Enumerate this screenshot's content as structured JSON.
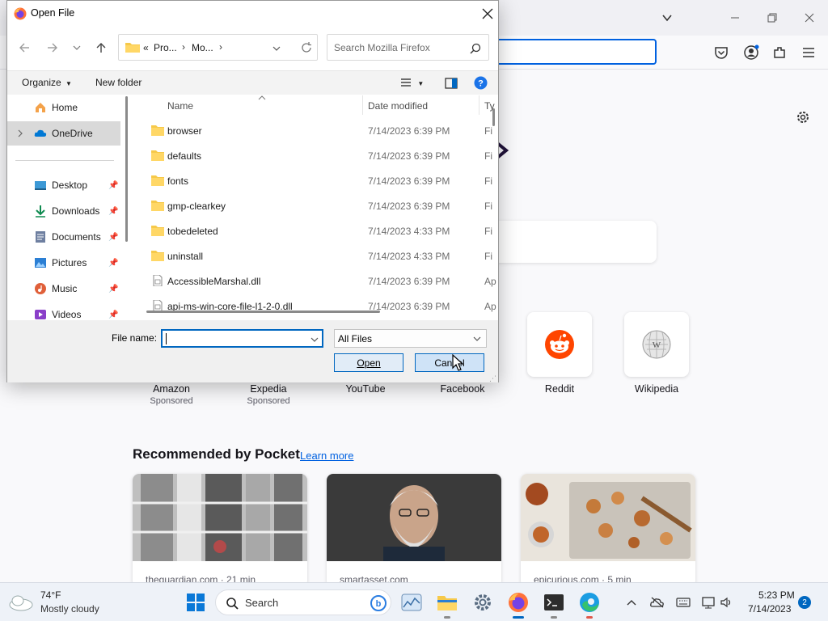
{
  "firefox": {
    "new_tab": {
      "top_sites": [
        {
          "label": "Amazon",
          "sublabel": "Sponsored"
        },
        {
          "label": "Expedia",
          "sublabel": "Sponsored"
        },
        {
          "label": "YouTube",
          "sublabel": ""
        },
        {
          "label": "Facebook",
          "sublabel": ""
        },
        {
          "label": "Reddit",
          "sublabel": ""
        },
        {
          "label": "Wikipedia",
          "sublabel": ""
        }
      ],
      "pocket": {
        "heading": "Recommended by Pocket",
        "learn_more": "Learn more",
        "cards": [
          {
            "source": "theguardian.com · 21 min"
          },
          {
            "source": "smartasset.com"
          },
          {
            "source": "epicurious.com · 5 min"
          }
        ]
      }
    }
  },
  "dialog": {
    "title": "Open File",
    "breadcrumb": {
      "prefix": "«",
      "items": [
        "Pro...",
        "Mo..."
      ]
    },
    "search_placeholder": "Search Mozilla Firefox",
    "commands": {
      "organize": "Organize",
      "new_folder": "New folder"
    },
    "nav": {
      "home": "Home",
      "onedrive": "OneDrive",
      "quick_access": [
        {
          "label": "Desktop",
          "icon": "desktop-icon"
        },
        {
          "label": "Downloads",
          "icon": "download-icon"
        },
        {
          "label": "Documents",
          "icon": "document-icon"
        },
        {
          "label": "Pictures",
          "icon": "pictures-icon"
        },
        {
          "label": "Music",
          "icon": "music-icon"
        },
        {
          "label": "Videos",
          "icon": "video-icon"
        }
      ]
    },
    "columns": {
      "name": "Name",
      "date": "Date modified",
      "type": "Ty"
    },
    "files": [
      {
        "name": "browser",
        "date": "7/14/2023 6:39 PM",
        "type": "Fi",
        "kind": "folder"
      },
      {
        "name": "defaults",
        "date": "7/14/2023 6:39 PM",
        "type": "Fi",
        "kind": "folder"
      },
      {
        "name": "fonts",
        "date": "7/14/2023 6:39 PM",
        "type": "Fi",
        "kind": "folder"
      },
      {
        "name": "gmp-clearkey",
        "date": "7/14/2023 6:39 PM",
        "type": "Fi",
        "kind": "folder"
      },
      {
        "name": "tobedeleted",
        "date": "7/14/2023 4:33 PM",
        "type": "Fi",
        "kind": "folder"
      },
      {
        "name": "uninstall",
        "date": "7/14/2023 4:33 PM",
        "type": "Fi",
        "kind": "folder"
      },
      {
        "name": "AccessibleMarshal.dll",
        "date": "7/14/2023 6:39 PM",
        "type": "Ap",
        "kind": "file"
      },
      {
        "name": "api-ms-win-core-file-l1-2-0.dll",
        "date": "7/14/2023 6:39 PM",
        "type": "Ap",
        "kind": "file"
      }
    ],
    "file_name_label": "File name:",
    "file_name_value": "",
    "filter": "All Files",
    "open_button": "Open",
    "cancel_button": "Cancel"
  },
  "taskbar": {
    "weather": {
      "temp": "74°F",
      "desc": "Mostly cloudy"
    },
    "search_label": "Search",
    "clock": {
      "time": "5:23 PM",
      "date": "7/14/2023"
    },
    "notifications": "2"
  },
  "colors": {
    "accent": "#0067c0",
    "firefox_blue": "#0061e0",
    "reddit": "#ff4500"
  }
}
